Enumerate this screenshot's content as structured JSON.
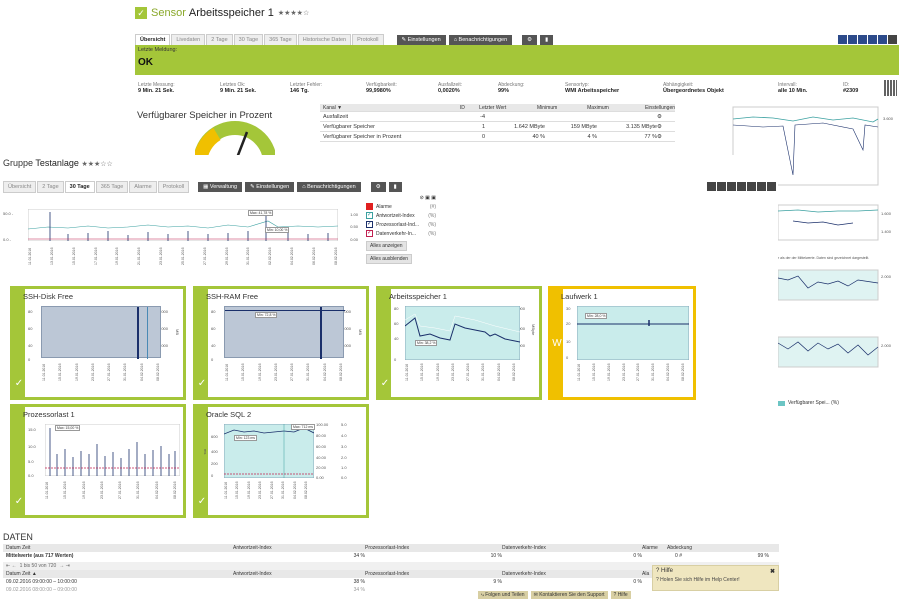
{
  "sensor": {
    "title_prefix": "Sensor",
    "title_name": "Arbeitsspeicher 1",
    "stars": "★★★★☆",
    "tabs": [
      "Übersicht",
      "Livedaten",
      "2 Tage",
      "30 Tage",
      "365 Tage",
      "Historische Daten",
      "Protokoll"
    ],
    "settings_label": "Einstellungen",
    "notifications_label": "Benachrichtigungen",
    "last_message_label": "Letzte Meldung:",
    "status": "OK",
    "stats": [
      {
        "label": "Letzte Messung:",
        "value": "9 Min. 21 Sek."
      },
      {
        "label": "Letztes Ok:",
        "value": "9 Min. 21 Sek."
      },
      {
        "label": "Letzter Fehler:",
        "value": "146 Tg."
      },
      {
        "label": "Verfügbarkeit:",
        "value": "99,9980%"
      },
      {
        "label": "Ausfallzeit:",
        "value": "0,0020%"
      },
      {
        "label": "Abdeckung:",
        "value": "99%"
      },
      {
        "label": "Sensortyp:",
        "value": "WMI Arbeitsspeicher"
      },
      {
        "label": "Abhängigkeit:",
        "value": "Übergeordnetes Objekt"
      },
      {
        "label": "Intervall:",
        "value": "alle 10 Min."
      },
      {
        "label": "ID:",
        "value": "#2309"
      }
    ],
    "gauge_title": "Verfügbarer Speicher in Prozent",
    "channel_headers": [
      "Kanal ▼",
      "ID",
      "Letzter Wert",
      "Minimum",
      "Maximum",
      "Einstellungen"
    ],
    "channels": [
      {
        "name": "Ausfallzeit",
        "id": "-4",
        "last": "",
        "min": "",
        "max": ""
      },
      {
        "name": "Verfügbarer Speicher",
        "id": "1",
        "last": "1.642 MByte",
        "min": "159 MByte",
        "max": "3.135 MByte"
      },
      {
        "name": "Verfügbarer Speicher in Prozent",
        "id": "0",
        "last": "40 %",
        "min": "4 %",
        "max": "77 %"
      }
    ],
    "right_legend": "Verfügbarer Spei... (%)",
    "right_note": "r als der der Mittelwerte. Daten sind gezeichnet dargestellt.",
    "right_y_labels": [
      "3.600",
      "1.600",
      "1.400",
      "2.000",
      "2.000"
    ]
  },
  "group": {
    "title_prefix": "Gruppe",
    "title_name": "Testanlage",
    "stars": "★★★☆☆",
    "tabs": [
      "Übersicht",
      "2 Tage",
      "30 Tage",
      "365 Tage",
      "Alarme",
      "Protokoll"
    ],
    "admin_label": "Verwaltung",
    "settings_label": "Einstellungen",
    "notifications_label": "Benachrichtigungen",
    "overview_chart": {
      "y_left": [
        "50.0 -",
        "0.0 -"
      ],
      "y_right": [
        "1.00",
        "0.50",
        "0.00"
      ],
      "max_label": "Max: 41,78 %",
      "min_label": "Min: 10,00 %",
      "dates": [
        "11.01.2016",
        "13.01.2016",
        "15.01.2016",
        "17.01.2016",
        "19.01.2016",
        "21.01.2016",
        "23.01.2016",
        "25.01.2016",
        "27.01.2016",
        "29.01.2016",
        "31.01.2016",
        "02.02.2016",
        "04.02.2016",
        "06.02.2016",
        "08.02.2016"
      ]
    },
    "legend": [
      {
        "label": "Alarme",
        "unit": "(#)",
        "color": "#e02020",
        "checked": false
      },
      {
        "label": "Antwortzeit-Index",
        "unit": "(%)",
        "color": "#3aa0a0",
        "checked": true
      },
      {
        "label": "Prozessorlast-Ind...",
        "unit": "(%)",
        "color": "#1a2f6a",
        "checked": true
      },
      {
        "label": "Datenverkehr-In...",
        "unit": "(%)",
        "color": "#c02050",
        "checked": true
      }
    ],
    "show_all": "Alles anzeigen",
    "hide_all": "Alles ausblenden"
  },
  "tiles": [
    {
      "title": "SSH-Disk Free",
      "yl": [
        "80",
        "60",
        "40",
        "20",
        "0"
      ],
      "yr": [
        "15.000",
        "10.000",
        "5.000",
        "0"
      ],
      "unit": "MB",
      "style": "blue",
      "status": "✓"
    },
    {
      "title": "SSH-RAM Free",
      "yl": [
        "80",
        "60",
        "40",
        "20",
        "0"
      ],
      "yr": [
        "15.000",
        "10.000",
        "5.000",
        "0"
      ],
      "unit": "MB",
      "note": "Min: 72,8 %",
      "style": "blue",
      "status": "✓"
    },
    {
      "title": "Arbeitsspeicher 1",
      "yl": [
        "80",
        "60",
        "40",
        "20",
        "0"
      ],
      "yr": [
        "3.000",
        "2.000",
        "1.000",
        "0"
      ],
      "unit": "MByte",
      "note": "Min: 38,2 %",
      "style": "teal",
      "status": "✓"
    },
    {
      "title": "Laufwerk 1",
      "yl": [
        "30",
        "20",
        "10",
        "0"
      ],
      "yr": [],
      "unit": "",
      "note": "Min: 28,0 %",
      "style": "teal",
      "status": "W"
    },
    {
      "title": "Prozessorlast 1",
      "yl": [
        "15.0",
        "10.0",
        "5.0",
        "0.0"
      ],
      "yr": [],
      "unit": "",
      "note": "Max: 15,00 %",
      "style": "white",
      "status": "✓"
    },
    {
      "title": "Oracle SQL 2",
      "yl": [
        "600",
        "400",
        "200",
        "0"
      ],
      "yr": [
        "100.00",
        "80.00",
        "60.00",
        "40.00",
        "20.00",
        "0.00"
      ],
      "yr2": [
        "5.0",
        "4.0",
        "3.0",
        "2.0",
        "1.0",
        "0.0"
      ],
      "unit": "ms",
      "note": "Max: 712 ms",
      "note2": "Min: 123 ms",
      "style": "teal",
      "status": "✓"
    }
  ],
  "tile_dates": [
    "11.01.2016",
    "13.01.2016",
    "15.01.2016",
    "17.01.2016",
    "19.01.2016",
    "21.01.2016",
    "23.01.2016",
    "25.01.2016",
    "27.01.2016",
    "29.01.2016",
    "31.01.2016",
    "02.02.2016",
    "04.02.2016",
    "06.02.2016",
    "08.02.2016"
  ],
  "data": {
    "heading": "DATEN",
    "headers": [
      "Datum Zeit",
      "Antwortzeit-Index",
      "Prozessorlast-Index",
      "Datenverkehr-Index",
      "Alarme",
      "Abdeckung"
    ],
    "avg_label": "Mittelwerte (aus 717 Werten)",
    "avg_values": [
      "34 %",
      "10 %",
      "0 %",
      "0 #",
      "99 %"
    ],
    "pager": "1 bis 50 von 720",
    "headers2": [
      "Datum Zeit ▲",
      "Antwortzeit-Index",
      "Prozessorlast-Index",
      "Datenverkehr-Index",
      "Ala"
    ],
    "rows": [
      {
        "date": "09.02.2016 09:00:00 – 10:00:00",
        "a": "38 %",
        "b": "9 %",
        "c": "0 %"
      },
      {
        "date": "09.02.2016 08:00:00 – 09:00:00",
        "a": "34 %",
        "b": "",
        "c": ""
      }
    ]
  },
  "footer": {
    "follow": "Folgen und Teilen",
    "support": "Kontaktieren Sie den Support",
    "help": "Hilfe"
  },
  "help_panel": {
    "title": "Hilfe",
    "text": "Holen Sie sich Hilfe im Help Center!"
  },
  "colors": {
    "green": "#a4c639",
    "yellow": "#f0c000",
    "teal": "#3aa0a0",
    "navy": "#1a2f6a"
  }
}
